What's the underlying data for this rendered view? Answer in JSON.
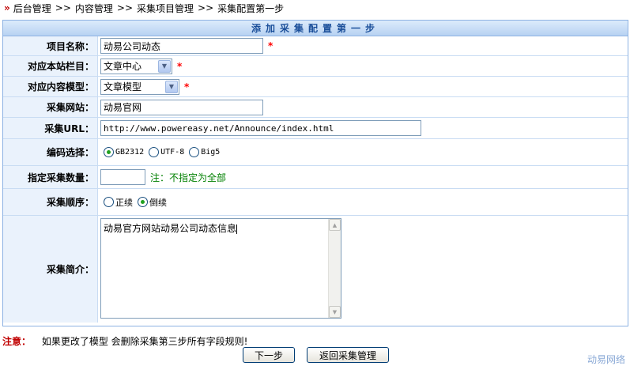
{
  "breadcrumb": {
    "items": [
      "后台管理",
      "内容管理",
      "采集项目管理",
      "采集配置第一步"
    ],
    "separator": ">>"
  },
  "panel": {
    "title": "添加采集配置第一步"
  },
  "fields": {
    "project_name": {
      "label": "项目名称：",
      "value": "动易公司动态",
      "required": "*"
    },
    "site_column": {
      "label": "对应本站栏目：",
      "value": "文章中心",
      "required": "*"
    },
    "content_model": {
      "label": "对应内容模型：",
      "value": "文章模型",
      "required": "*"
    },
    "site_name": {
      "label": "采集网站：",
      "value": "动易官网"
    },
    "url": {
      "label": "采集URL：",
      "value": "http://www.powereasy.net/Announce/index.html"
    },
    "encoding": {
      "label": "编码选择：",
      "options": [
        "GB2312",
        "UTF-8",
        "Big5"
      ],
      "selected": "GB2312"
    },
    "count": {
      "label": "指定采集数量：",
      "value": "",
      "note": "注：不指定为全部"
    },
    "order": {
      "label": "采集顺序：",
      "options": [
        "正续",
        "倒续"
      ],
      "selected": "倒续"
    },
    "intro": {
      "label": "采集简介：",
      "value": "动易官方网站动易公司动态信息"
    }
  },
  "warning": {
    "label": "注意：",
    "text": "如果更改了模型 会删除采集第三步所有字段规则!"
  },
  "buttons": {
    "next": "下一步",
    "back": "返回采集管理"
  },
  "brand": "动易网络",
  "colors": {
    "accent": "#1b4f9a",
    "label_bg": "#eaf2fc",
    "required": "#ff0000",
    "note": "#008000"
  }
}
